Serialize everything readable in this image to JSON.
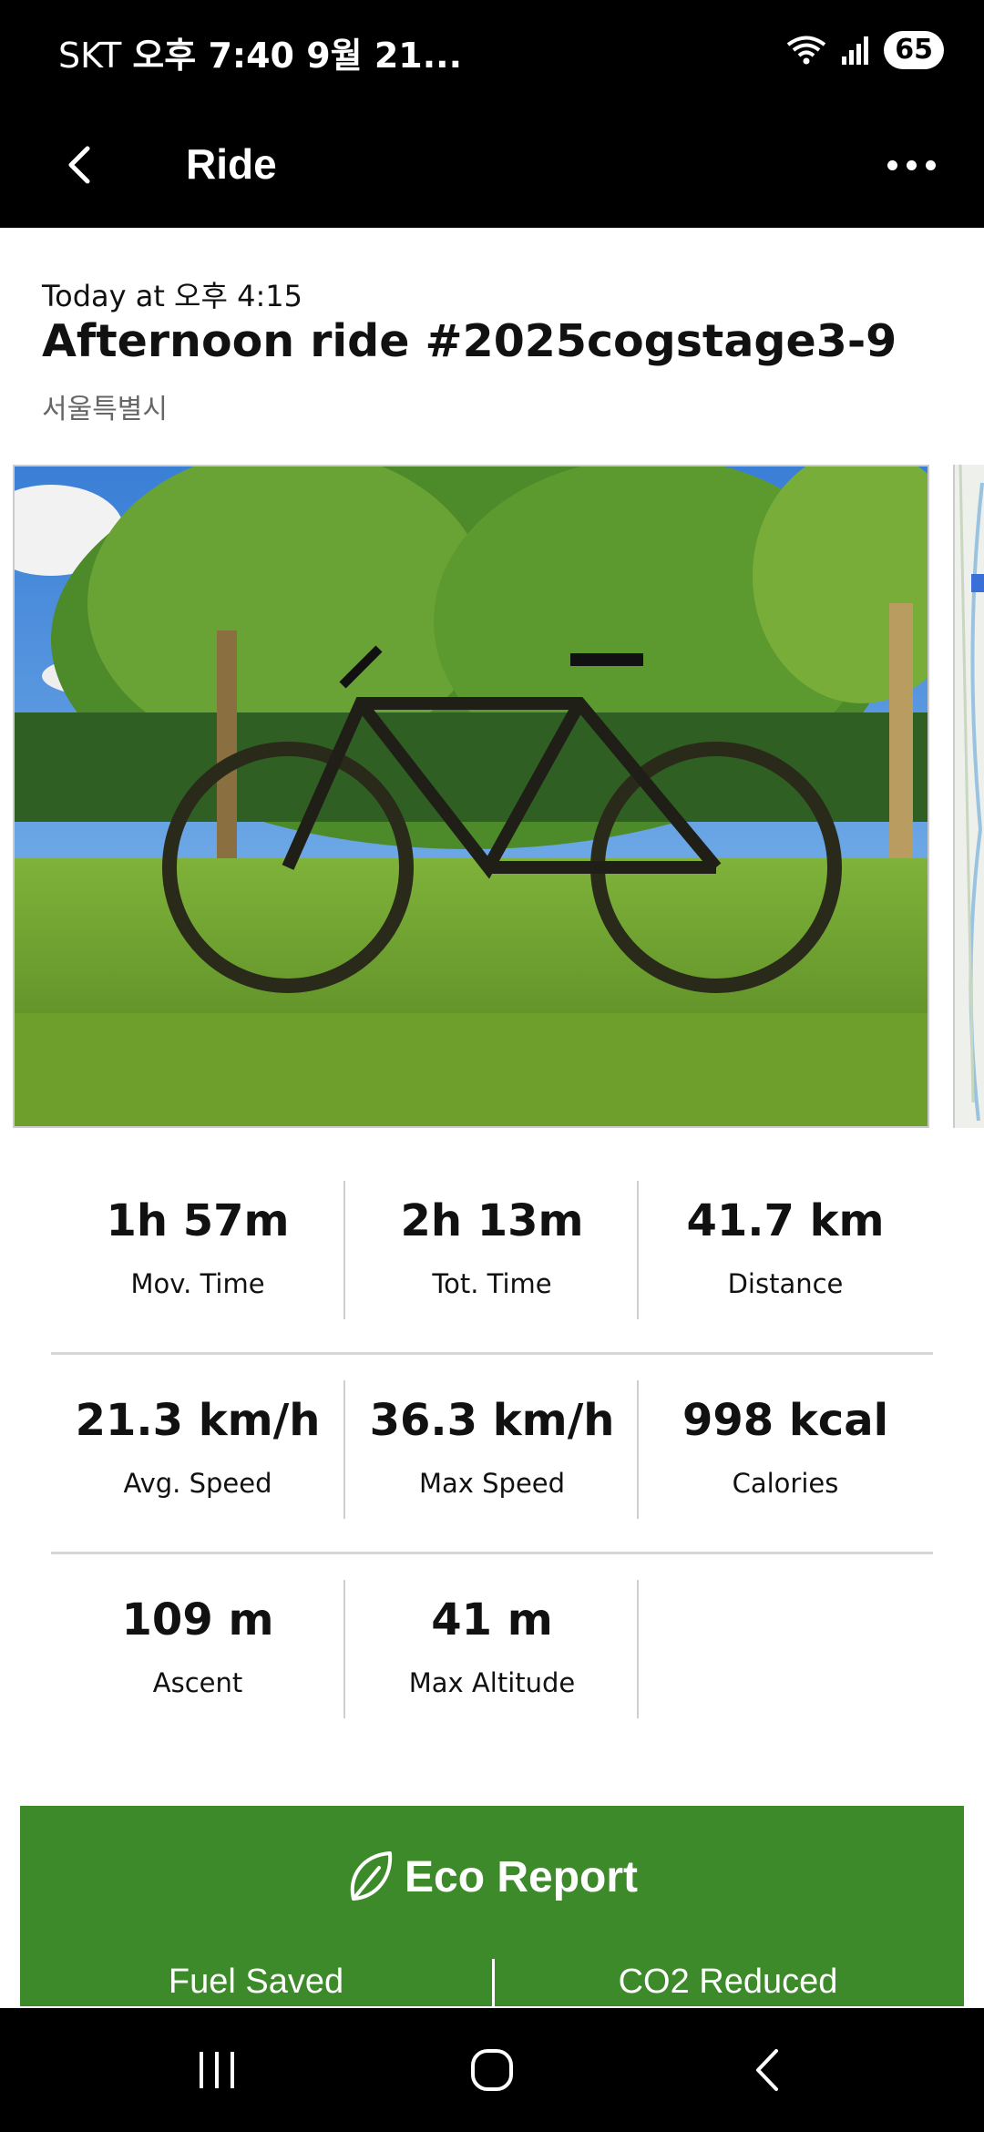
{
  "status_bar": {
    "carrier": "SKT",
    "time_date": "오후 7:40  9월 21...",
    "battery": "65",
    "icons": [
      "wifi-icon",
      "signal-icon",
      "battery-icon"
    ]
  },
  "app_bar": {
    "title": "Ride",
    "back_icon": "chevron-left-icon",
    "more_icon": "more-horizontal-icon"
  },
  "ride": {
    "date": "Today at 오후 4:15",
    "title": "Afternoon ride #2025cogstage3-9",
    "location": "서울특별시"
  },
  "stats": [
    {
      "value": "1h 57m",
      "label": "Mov. Time"
    },
    {
      "value": "2h 13m",
      "label": "Tot. Time"
    },
    {
      "value": "41.7 km",
      "label": "Distance"
    },
    {
      "value": "21.3 km/h",
      "label": "Avg. Speed"
    },
    {
      "value": "36.3 km/h",
      "label": "Max Speed"
    },
    {
      "value": "998 kcal",
      "label": "Calories"
    },
    {
      "value": "109 m",
      "label": "Ascent"
    },
    {
      "value": "41 m",
      "label": "Max Altitude"
    }
  ],
  "eco_report": {
    "title": "Eco Report",
    "fuel_saved_label": "Fuel Saved",
    "co2_reduced_label": "CO2 Reduced",
    "icon": "leaf-icon"
  },
  "colors": {
    "bar_background": "#000000",
    "eco_green": "#3d8a2a",
    "divider": "#d6d6d6"
  },
  "nav_bar": {
    "icons": [
      "recents-icon",
      "home-icon",
      "back-icon"
    ]
  }
}
